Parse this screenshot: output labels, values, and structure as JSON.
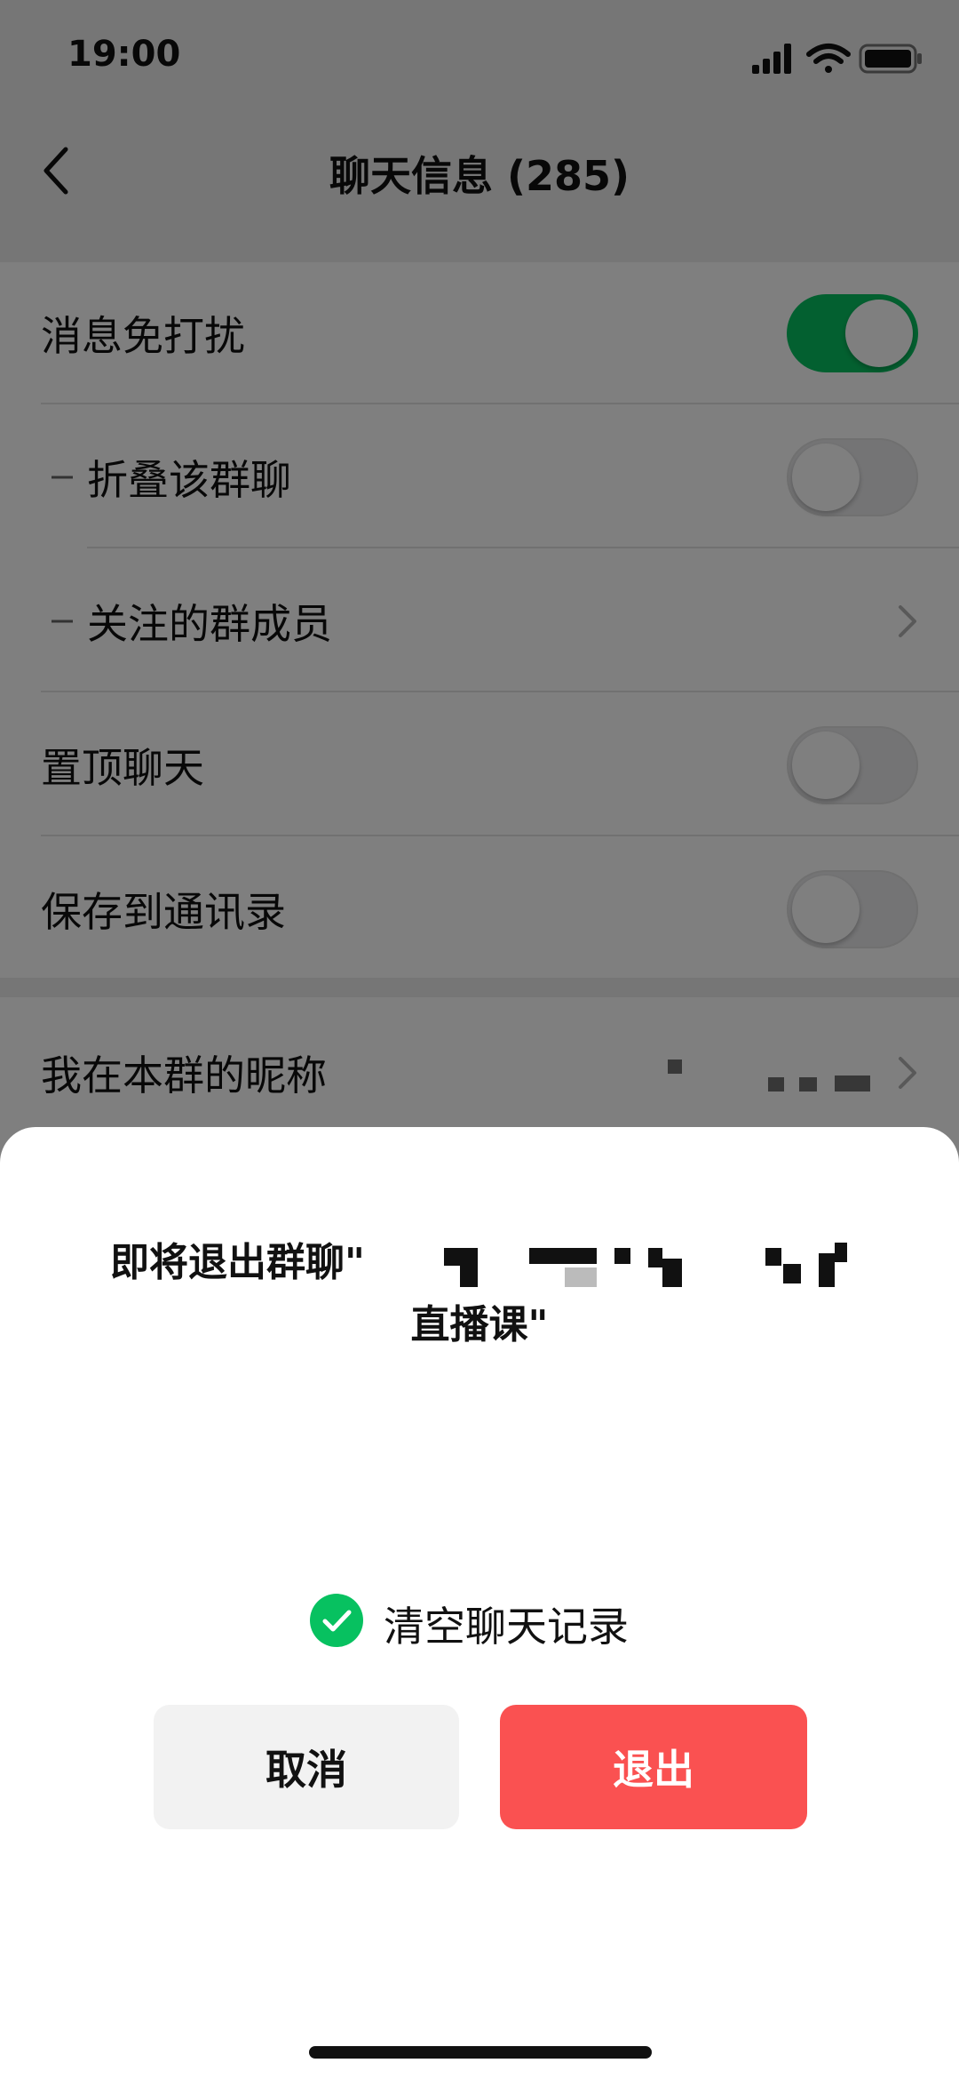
{
  "status_bar": {
    "time": "19:00",
    "icons": [
      "signal-icon",
      "wifi-icon",
      "battery-icon"
    ]
  },
  "nav": {
    "title": "聊天信息 (285)",
    "back_icon": "back-chevron-icon"
  },
  "settings": {
    "mute": {
      "label": "消息免打扰",
      "on": true
    },
    "fold": {
      "label": "折叠该群聊",
      "on": false
    },
    "followed": {
      "label": "关注的群成员"
    },
    "pin": {
      "label": "置顶聊天",
      "on": false
    },
    "save_contacts": {
      "label": "保存到通讯录",
      "on": false
    },
    "nickname": {
      "label": "我在本群的昵称"
    }
  },
  "dialog": {
    "message_start": "即将退出群聊\"",
    "message_end": "直播课\"",
    "clear_history_label": "清空聊天记录",
    "clear_history_checked": true,
    "cancel_label": "取消",
    "exit_label": "退出"
  },
  "colors": {
    "accent_green": "#07c160",
    "danger_red": "#fa5151"
  }
}
